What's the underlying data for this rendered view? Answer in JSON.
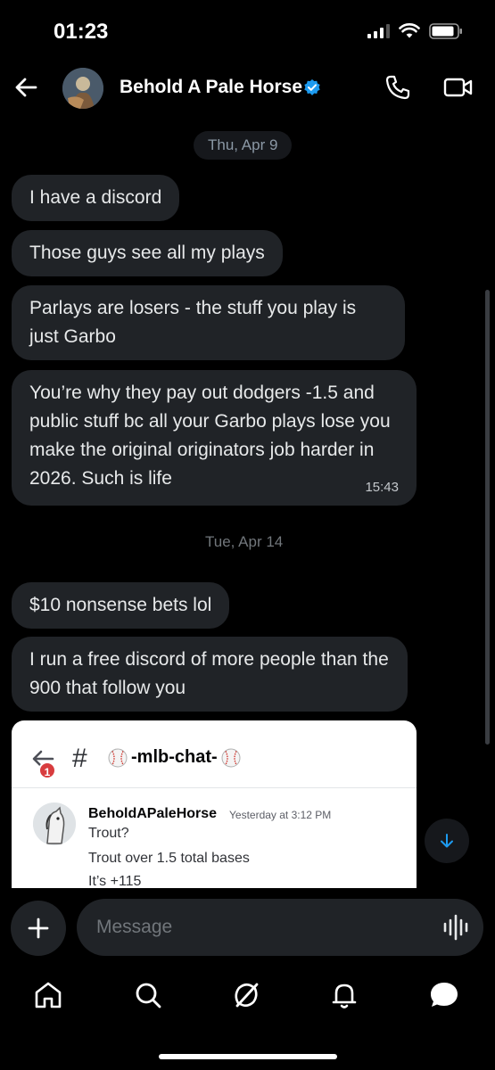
{
  "status_bar": {
    "time": "01:23"
  },
  "header": {
    "contact_name": "Behold A Pale Horse"
  },
  "conversation": {
    "date_1": "Thu, Apr 9",
    "messages_1": [
      {
        "text": "I have a discord"
      },
      {
        "text": "Those guys see all my plays"
      },
      {
        "text": "Parlays are losers - the stuff you play is just Garbo"
      },
      {
        "text": "You’re why they pay out dodgers -1.5 and public stuff bc all your Garbo plays lose you make the original originators job harder in 2026. Such is life",
        "time": "15:43"
      }
    ],
    "date_2": "Tue, Apr 14",
    "messages_2": [
      {
        "text": "$10 nonsense bets lol"
      },
      {
        "text": "I run a free discord of more people than the 900 that follow you"
      }
    ]
  },
  "shared_image": {
    "badge_count": "1",
    "hash": "#",
    "channel_name": "-mlb-chat-",
    "username": "BeholdAPaleHorse",
    "timestamp": "Yesterday at 3:12 PM",
    "lines": [
      "Trout?",
      "Trout over 1.5 total bases",
      "It’s +115"
    ]
  },
  "composer": {
    "placeholder": "Message"
  },
  "colors": {
    "accent": "#1d9bf0",
    "bubble": "#202327",
    "background": "#000000",
    "badge": "#d83c3e"
  },
  "nav": {
    "icons": [
      "home-icon",
      "search-icon",
      "grok-icon",
      "notifications-icon",
      "messages-icon"
    ]
  }
}
